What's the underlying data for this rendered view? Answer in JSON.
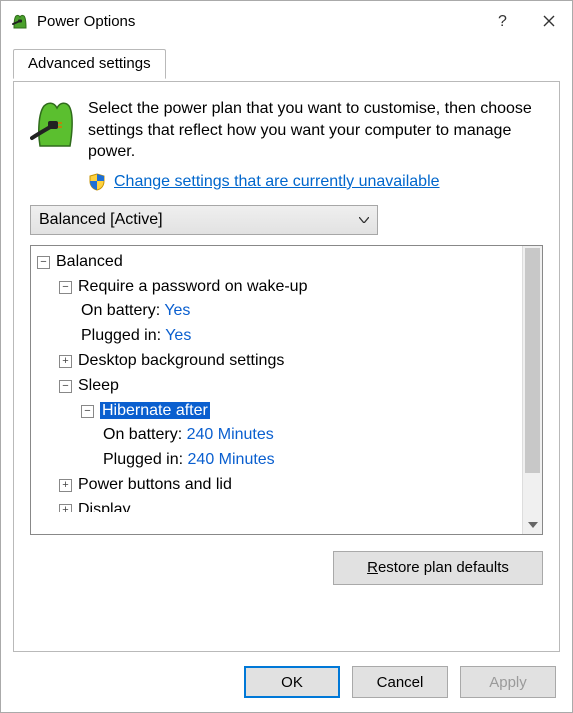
{
  "titlebar": {
    "title": "Power Options"
  },
  "tab": {
    "label": "Advanced settings"
  },
  "intro": "Select the power plan that you want to customise, then choose settings that reflect how you want your computer to manage power.",
  "shield_link": "Change settings that are currently unavailable",
  "plan_selector": {
    "value": "Balanced [Active]"
  },
  "tree": {
    "balanced": {
      "label": "Balanced",
      "require_password": {
        "label": "Require a password on wake-up",
        "on_battery_label": "On battery:",
        "on_battery_value": "Yes",
        "plugged_in_label": "Plugged in:",
        "plugged_in_value": "Yes"
      },
      "desktop_bg": {
        "label": "Desktop background settings"
      },
      "sleep": {
        "label": "Sleep",
        "hibernate_after": {
          "label": "Hibernate after",
          "on_battery_label": "On battery:",
          "on_battery_value": "240 Minutes",
          "plugged_in_label": "Plugged in:",
          "plugged_in_value": "240 Minutes"
        }
      },
      "power_buttons": {
        "label": "Power buttons and lid"
      },
      "display": {
        "label": "Display"
      }
    }
  },
  "buttons": {
    "restore_pre": "R",
    "restore_post": "estore plan defaults",
    "ok": "OK",
    "cancel": "Cancel",
    "apply": "Apply"
  }
}
